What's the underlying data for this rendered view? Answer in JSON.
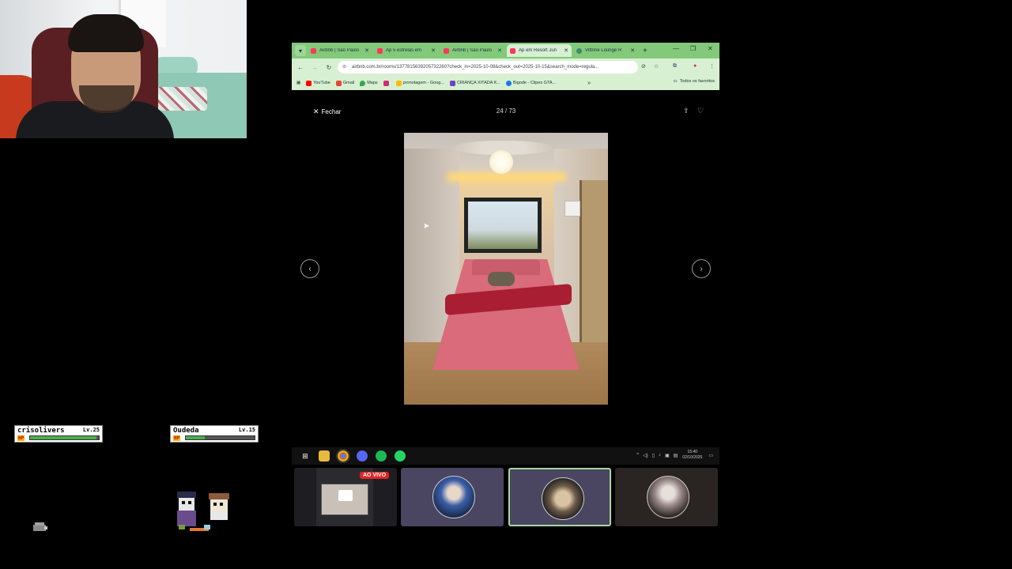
{
  "browser": {
    "tabs": [
      {
        "label": "Airbnb | São Paulo",
        "active": false
      },
      {
        "label": "Ap 5 estrelas em",
        "active": false
      },
      {
        "label": "Airbnb | São Paulo",
        "active": false
      },
      {
        "label": "Ap em Resort Jun",
        "active": true
      },
      {
        "label": "Vittrine Lounge R",
        "active": false
      }
    ],
    "url": "airbnb.com.br/rooms/1377815639205732260?check_in=2025-10-08&check_out=2025-10-15&search_mode=regula...",
    "bookmarks": [
      {
        "label": "YouTube",
        "color": "#ff0000"
      },
      {
        "label": "Gmail",
        "color": "#ea4335"
      },
      {
        "label": "Maps",
        "color": "#34a853"
      },
      {
        "label": "",
        "color": "#d62976"
      },
      {
        "label": "pronotagem - Goog...",
        "color": "#fbbc04"
      },
      {
        "label": "CRIANÇA XITADA K...",
        "color": "#6f42c1"
      },
      {
        "label": "Bigode - Clipes GTA...",
        "color": "#1877f2"
      }
    ],
    "all_bookmarks": "Todos os favoritos"
  },
  "gallery": {
    "close_label": "Fechar",
    "counter": "24 / 73"
  },
  "hud": {
    "players": [
      {
        "name": "crisolivers",
        "level": "Lv.25",
        "hp_label": "HP",
        "hp_fraction": 0.97
      },
      {
        "name": "Oudeda",
        "level": "Lv.15",
        "hp_label": "HP",
        "hp_fraction": 0.28
      }
    ]
  },
  "taskbar": {
    "time": "15:40",
    "date": "02/10/2025"
  },
  "call": {
    "live_label": "AO VIVO"
  },
  "colors": {
    "browser_frame": "#82c97a",
    "browser_toolbar": "#d7f0d2",
    "live_red": "#e02424",
    "active_tile_border": "#a8d8a0"
  }
}
